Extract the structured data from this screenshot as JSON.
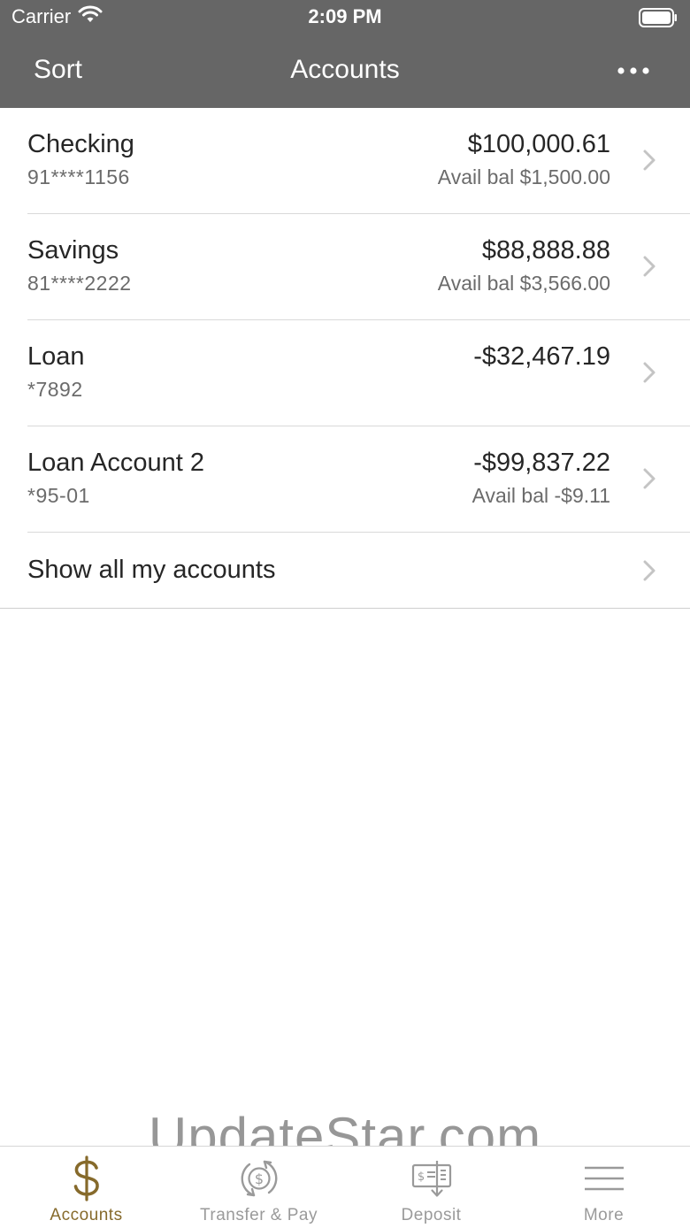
{
  "colors": {
    "header_bg": "#666666",
    "accent": "#866a2b",
    "tab_inactive": "#9a9a9a",
    "secondary_text": "#6b6b6b"
  },
  "status_bar": {
    "carrier": "Carrier",
    "time": "2:09 PM"
  },
  "nav": {
    "left_button": "Sort",
    "title": "Accounts",
    "right_icon": "more-dots-icon"
  },
  "accounts": [
    {
      "name": "Checking",
      "number": "91****1156",
      "balance": "$100,000.61",
      "avail": "Avail bal $1,500.00"
    },
    {
      "name": "Savings",
      "number": "81****2222",
      "balance": "$88,888.88",
      "avail": "Avail bal $3,566.00"
    },
    {
      "name": "Loan",
      "number": "*7892",
      "balance": "-$32,467.19",
      "avail": ""
    },
    {
      "name": "Loan Account 2",
      "number": "*95-01",
      "balance": "-$99,837.22",
      "avail": "Avail bal -$9.11"
    }
  ],
  "show_all": {
    "label": "Show all my accounts"
  },
  "watermark": "UpdateStar.com",
  "tabs": [
    {
      "label": "Accounts",
      "icon": "dollar-sign-icon",
      "active": true
    },
    {
      "label": "Transfer & Pay",
      "icon": "transfer-cycle-dollar-icon",
      "active": false
    },
    {
      "label": "Deposit",
      "icon": "check-deposit-icon",
      "active": false
    },
    {
      "label": "More",
      "icon": "hamburger-menu-icon",
      "active": false
    }
  ]
}
